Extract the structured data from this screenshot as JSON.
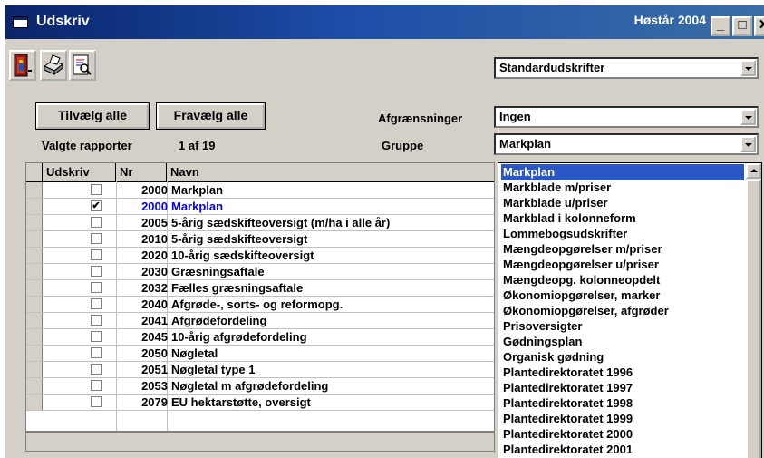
{
  "window": {
    "title": "Udskriv",
    "right_text": "Høstår 2004",
    "minimize_label": "_",
    "maximize_label": "□",
    "close_label": "✕"
  },
  "toolbar": {
    "report_type": "Standardudskrifter"
  },
  "buttons": {
    "select_all": "Tilvælg alle",
    "deselect_all": "Fravælg alle"
  },
  "filters": {
    "restrictions_label": "Afgrænsninger",
    "restrictions_value": "Ingen",
    "group_label": "Gruppe",
    "group_value": "Markplan"
  },
  "selection": {
    "label": "Valgte rapporter",
    "count": "1 af 19"
  },
  "grid": {
    "columns": {
      "print": "Udskriv",
      "nr": "Nr",
      "name": "Navn"
    },
    "rows": [
      {
        "nr": "2000",
        "name": "Markplan",
        "checked": ""
      },
      {
        "nr": "2000",
        "name": "Markplan",
        "checked": "✔"
      },
      {
        "nr": "2005",
        "name": "5-årig sædskifteoversigt (m/ha i alle år)",
        "checked": ""
      },
      {
        "nr": "2010",
        "name": "5-årig sædskifteoversigt",
        "checked": ""
      },
      {
        "nr": "2020",
        "name": "10-årig sædskifteoversigt",
        "checked": ""
      },
      {
        "nr": "2030",
        "name": "Græsningsaftale",
        "checked": ""
      },
      {
        "nr": "2032",
        "name": "Fælles græsningsaftale",
        "checked": ""
      },
      {
        "nr": "2040",
        "name": "Afgrøde-, sorts- og reformopg.",
        "checked": ""
      },
      {
        "nr": "2041",
        "name": "Afgrødefordeling",
        "checked": ""
      },
      {
        "nr": "2045",
        "name": "10-årig afgrødefordeling",
        "checked": ""
      },
      {
        "nr": "2050",
        "name": "Nøgletal",
        "checked": ""
      },
      {
        "nr": "2051",
        "name": "Nøgletal type 1",
        "checked": ""
      },
      {
        "nr": "2053",
        "name": "Nøgletal m afgrødefordeling",
        "checked": ""
      },
      {
        "nr": "2079",
        "name": "EU hektarstøtte, oversigt",
        "checked": ""
      }
    ]
  },
  "dropdown": {
    "items": [
      "Markplan",
      "Markblade m/priser",
      "Markblade u/priser",
      "Markblad i kolonneform",
      "Lommebogsudskrifter",
      "Mængdeopgørelser m/priser",
      "Mængdeopgørelser u/priser",
      "Mængdeopg. kolonneopdelt",
      "Økonomiopgørelser, marker",
      "Økonomiopgørelser, afgrøder",
      "Prisoversigter",
      "Gødningsplan",
      "Organisk gødning",
      "Plantedirektoratet 1996",
      "Plantedirektoratet 1997",
      "Plantedirektoratet 1998",
      "Plantedirektoratet 1999",
      "Plantedirektoratet 2000",
      "Plantedirektoratet 2001"
    ]
  },
  "colors": {
    "title_bar": "#0a246a",
    "highlight": "#2a56c6",
    "selected_row_text": "#0000ff"
  }
}
